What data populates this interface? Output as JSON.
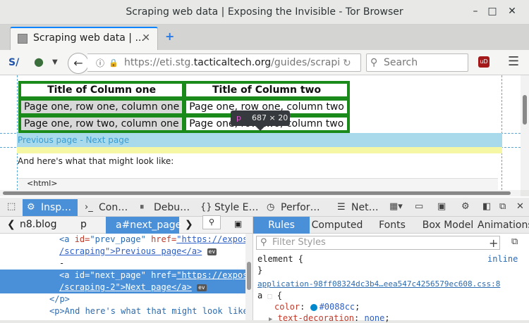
{
  "window": {
    "title": "Scraping web data | Exposing the Invisible - Tor Browser",
    "min": "–",
    "max": "□",
    "close": "✕"
  },
  "tab": {
    "label": "Scraping web data | ...",
    "close": "✕",
    "new": "+"
  },
  "nav": {
    "url_prefix": "https://eti.stg.",
    "url_domain": "tacticaltech.org",
    "url_path": "/guides/scrapi",
    "search_placeholder": "Search"
  },
  "page": {
    "table": {
      "headers": [
        "Title of Column one",
        "Title of Column two"
      ],
      "rows": [
        [
          "Page one, row one, column one",
          "Page one, row one, column two"
        ],
        [
          "Page one, row two, column one",
          "Page one, row two, column two"
        ]
      ]
    },
    "pager": "Previous page - Next page",
    "para": "And here's what that might look like:",
    "code": "<html>"
  },
  "tooltip": {
    "tag": "p",
    "size": "687 × 20"
  },
  "devtools": {
    "tabs": [
      "Insp…",
      "Con…",
      "Debu…",
      "Style E…",
      "Perfor…",
      "Net…"
    ],
    "breadcrumb": [
      "n8.blog",
      "p",
      "a#next_page"
    ],
    "markup": [
      {
        "pre": "<a ",
        "id": "id=",
        "idv": "\"prev_page\"",
        "href": " href=",
        "hv": "\"https://exposi"
      },
      {
        "text": "/scraping\">Previous page</a>"
      },
      {
        "text": "-"
      },
      {
        "pre": "<a ",
        "id": "id=",
        "idv": "\"next_page\"",
        "href": " href=",
        "hv": "\"https://exposi"
      },
      {
        "text": "/scraping-2\">Next page</a>"
      },
      {
        "text": "</p>"
      },
      {
        "text": "<p>And here's what that might look like"
      }
    ],
    "side_tabs": [
      "Rules",
      "Computed",
      "Fonts",
      "Box Model",
      "Animations"
    ],
    "filter_placeholder": "Filter Styles",
    "rules": {
      "element": "element {",
      "inline": "inline",
      "close": "}",
      "source": "application-98ff08324dc3b4…eea547c4256579ec608.css:8",
      "selector": "a",
      "open": "{",
      "color_prop": "color",
      "color_val": "#0088cc",
      "td_prop": "text-decoration",
      "td_val": "none"
    },
    "ev": "ev"
  }
}
